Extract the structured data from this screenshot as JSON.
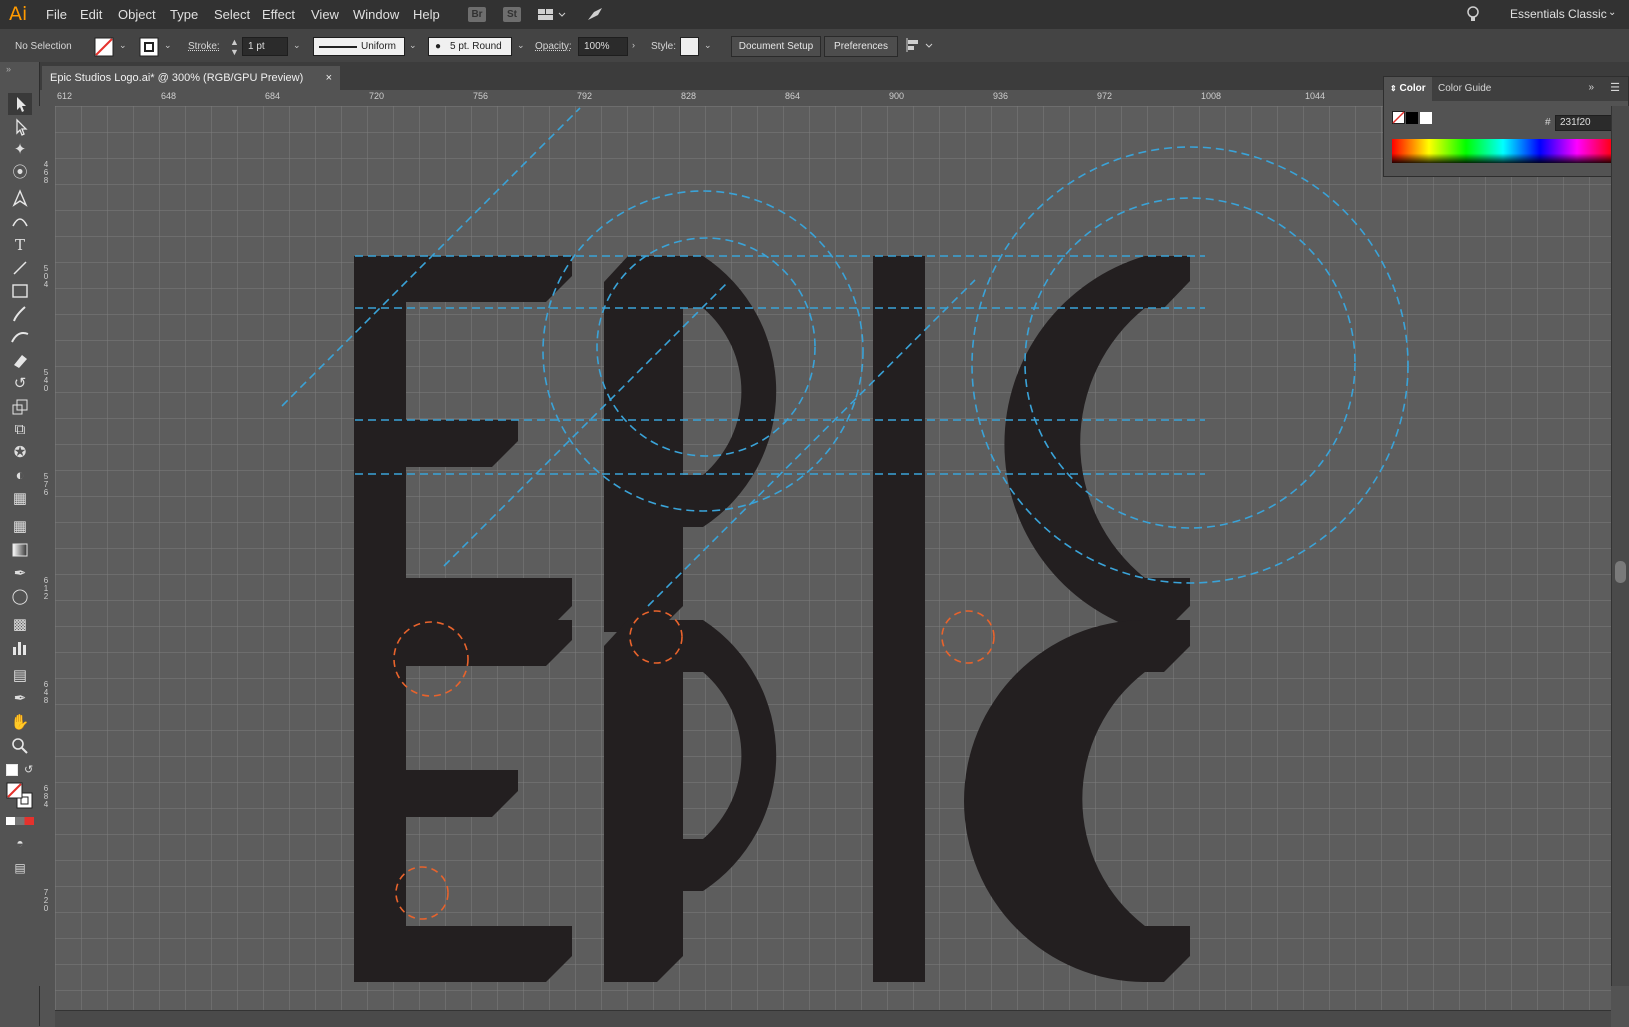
{
  "app": {
    "logo": "Ai"
  },
  "menubar": {
    "items": [
      "File",
      "Edit",
      "Object",
      "Type",
      "Select",
      "Effect",
      "View",
      "Window",
      "Help"
    ],
    "bridge": "Br",
    "stock": "St",
    "workspace": "Essentials Classic"
  },
  "controlbar": {
    "selection_state": "No Selection",
    "stroke_label": "Stroke:",
    "stroke_weight": "1 pt",
    "stroke_profile": "Uniform",
    "brush": "5 pt. Round",
    "opacity_label": "Opacity:",
    "opacity": "100%",
    "style_label": "Style:",
    "document_setup": "Document Setup",
    "preferences": "Preferences"
  },
  "document": {
    "tab_title": "Epic Studios Logo.ai* @ 300% (RGB/GPU Preview)",
    "close": "×"
  },
  "ruler": {
    "top_labels": [
      "612",
      "648",
      "684",
      "720",
      "756",
      "792",
      "828",
      "864",
      "900",
      "936",
      "972",
      "1008",
      "1044"
    ],
    "left_labels": [
      "468",
      "504",
      "540",
      "576",
      "612",
      "648",
      "684",
      "720"
    ]
  },
  "color_panel": {
    "tabs": [
      "Color",
      "Color Guide"
    ],
    "hex_symbol": "#",
    "hex": "231f20"
  },
  "colors": {
    "logo_fill": "#231f20",
    "guide_blue": "#3aa3d8",
    "guide_orange": "#e8632c",
    "grid_line": "#8a8a8a",
    "canvas_bg": "#5d5d5d"
  }
}
